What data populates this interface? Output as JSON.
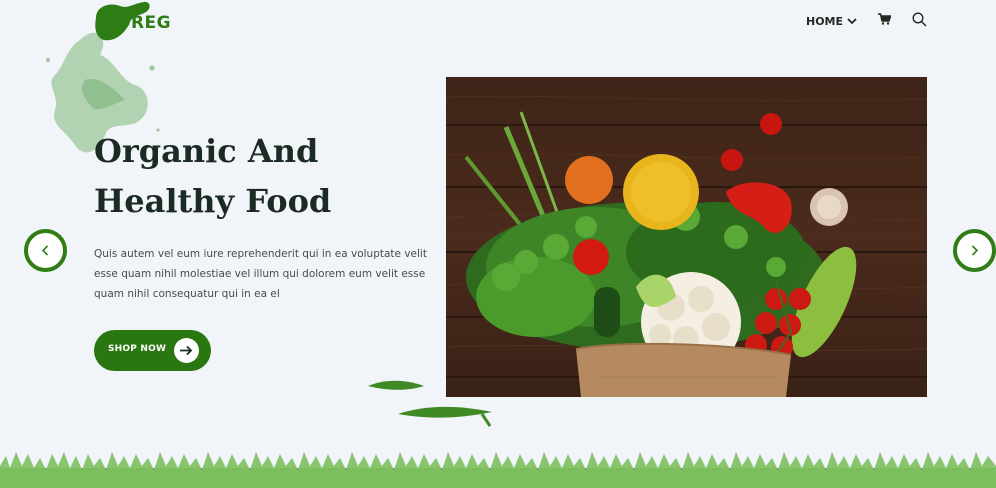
{
  "brand": {
    "logo_text": "OREG",
    "accent_color": "#2a7711"
  },
  "nav": {
    "home_label": "HOME",
    "home_icon": "chevron-down-icon",
    "cart_icon": "cart-icon",
    "search_icon": "search-icon"
  },
  "hero": {
    "title_line1": "Organic And",
    "title_line2": "Healthy Food",
    "description": "Quis autem vel eum iure reprehenderit qui in ea voluptate velit esse quam nihil molestiae vel illum qui dolorem eum velit esse quam nihil consequatur qui in ea el",
    "cta_label": "SHOP NOW",
    "cta_icon": "arrow-right-icon",
    "image_subject": "vegetables-in-paper-bag"
  },
  "slider": {
    "prev_icon": "chevron-left-icon",
    "next_icon": "chevron-right-icon"
  }
}
